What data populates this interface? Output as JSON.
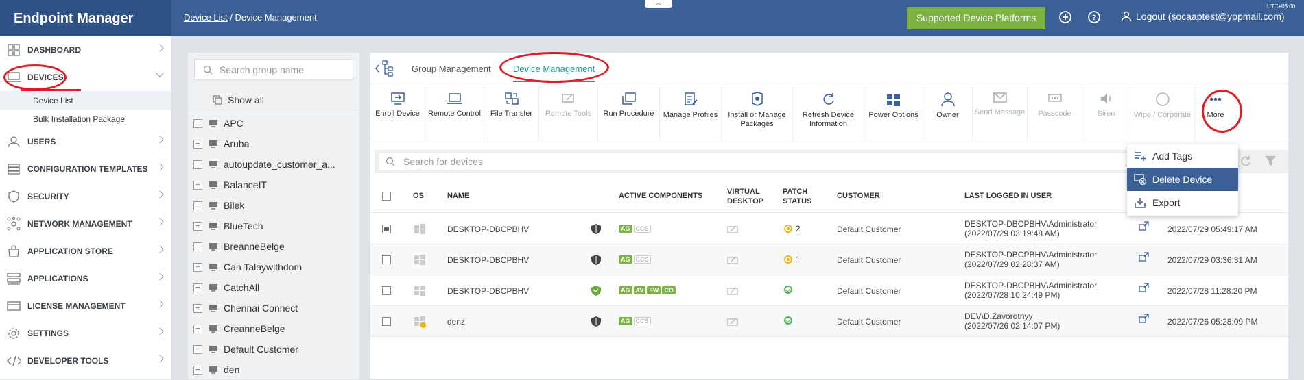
{
  "app": {
    "title": "Endpoint Manager"
  },
  "breadcrumb": {
    "link": "Device List",
    "separator": "/",
    "current": "Device Management"
  },
  "topbar": {
    "supported_platforms": "Supported Device Platforms",
    "logout": "Logout (socaaptest@yopmail.com)",
    "utc": "UTC+03:00"
  },
  "sidebar": {
    "items": [
      {
        "label": "DASHBOARD",
        "icon": "dashboard-icon"
      },
      {
        "label": "DEVICES",
        "icon": "devices-icon"
      },
      {
        "label": "USERS",
        "icon": "users-icon"
      },
      {
        "label": "CONFIGURATION TEMPLATES",
        "icon": "config-templates-icon"
      },
      {
        "label": "SECURITY",
        "icon": "security-icon"
      },
      {
        "label": "NETWORK MANAGEMENT",
        "icon": "network-icon"
      },
      {
        "label": "APPLICATION STORE",
        "icon": "app-store-icon"
      },
      {
        "label": "APPLICATIONS",
        "icon": "applications-icon"
      },
      {
        "label": "LICENSE MANAGEMENT",
        "icon": "license-icon"
      },
      {
        "label": "SETTINGS",
        "icon": "settings-icon"
      },
      {
        "label": "DEVELOPER TOOLS",
        "icon": "developer-tools-icon"
      }
    ],
    "devices_sub": [
      "Device List",
      "Bulk Installation Package"
    ]
  },
  "groups": {
    "search_placeholder": "Search group name",
    "show_all": "Show all",
    "items": [
      "APC",
      "Aruba",
      "autoupdate_customer_a...",
      "BalanceIT",
      "Bilek",
      "BlueTech",
      "BreanneBelge",
      "Can Talaywithdom",
      "CatchAll",
      "Chennai Connect",
      "CreanneBelge",
      "Default Customer",
      "den"
    ]
  },
  "tabs": {
    "group": "Group Management",
    "device": "Device Management"
  },
  "toolbar": {
    "buttons": [
      {
        "label": "Enroll Device",
        "icon": "enroll-device-icon"
      },
      {
        "label": "Remote Control",
        "icon": "remote-control-icon"
      },
      {
        "label": "File Transfer",
        "icon": "file-transfer-icon"
      },
      {
        "label": "Remote Tools",
        "icon": "remote-tools-icon"
      },
      {
        "label": "Run Procedure",
        "icon": "run-procedure-icon"
      },
      {
        "label": "Manage Profiles",
        "icon": "manage-profiles-icon"
      },
      {
        "label": "Install or Manage Packages",
        "icon": "install-packages-icon"
      },
      {
        "label": "Refresh Device Information",
        "icon": "refresh-device-icon"
      },
      {
        "label": "Power Options",
        "icon": "power-options-icon"
      },
      {
        "label": "Owner",
        "icon": "owner-icon"
      },
      {
        "label": "Send Message",
        "icon": "send-message-icon"
      },
      {
        "label": "Passcode",
        "icon": "passcode-icon"
      },
      {
        "label": "Siren",
        "icon": "siren-icon"
      },
      {
        "label": "Wipe / Corporate",
        "icon": "wipe-icon"
      },
      {
        "label": "More",
        "icon": "more-icon"
      }
    ]
  },
  "device_search": {
    "placeholder": "Search for devices"
  },
  "more_menu": {
    "items": [
      "Add Tags",
      "Delete Device",
      "Export"
    ]
  },
  "table": {
    "headers": {
      "os": "OS",
      "name": "NAME",
      "active_components": "ACTIVE COMPONENTS",
      "virtual": "VIRTUAL",
      "desktop": "DESKTOP",
      "patch": "PATCH",
      "status": "STATUS",
      "customer": "CUSTOMER",
      "last_logged": "LAST LOGGED IN USER"
    },
    "rows": [
      {
        "name": "DESKTOP-DBCPBHV",
        "components": [
          "AG",
          "CCS"
        ],
        "patch": "2",
        "customer": "Default Customer",
        "user": "DESKTOP-DBCPBHV\\Administrator",
        "user_time": "(2022/07/29 03:19:48 AM)",
        "last": "2022/07/29 05:49:17 AM"
      },
      {
        "name": "DESKTOP-DBCPBHV",
        "components": [
          "AG",
          "CCS"
        ],
        "patch": "1",
        "customer": "Default Customer",
        "user": "DESKTOP-DBCPBHV\\Administrator",
        "user_time": "(2022/07/29 02:28:37 AM)",
        "last": "2022/07/29 03:36:31 AM"
      },
      {
        "name": "DESKTOP-DBCPBHV",
        "components": [
          "AG",
          "AV",
          "FW",
          "CO"
        ],
        "patch": "",
        "customer": "Default Customer",
        "user": "DESKTOP-DBCPBHV\\Administrator",
        "user_time": "(2022/07/28 10:24:49 PM)",
        "last": "2022/07/28 11:28:20 PM"
      },
      {
        "name": "denz",
        "components": [
          "AG",
          "CCS"
        ],
        "patch": "",
        "customer": "Default Customer",
        "user": "DEV\\D.Zavorotnyy",
        "user_time": "(2022/07/26 02:14:07 PM)",
        "last": "2022/07/26 05:28:09 PM"
      }
    ]
  },
  "colors": {
    "header_bg": "#3b6096",
    "brand_bg": "#2f5286",
    "accent": "#1a9b8f",
    "green_button": "#7cb342",
    "annotation": "#e01b24"
  }
}
